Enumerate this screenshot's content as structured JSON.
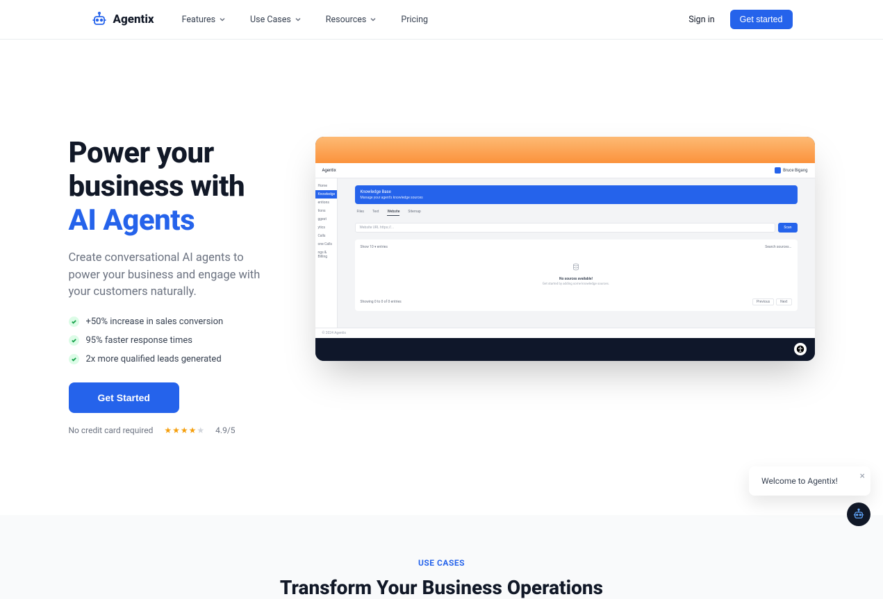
{
  "header": {
    "brand": "Agentix",
    "nav": [
      "Features",
      "Use Cases",
      "Resources",
      "Pricing"
    ],
    "signin": "Sign in",
    "cta": "Get started"
  },
  "hero": {
    "title_a": "Power your business with",
    "title_b": "AI Agents",
    "sub": "Create conversational AI agents to power your business and engage with your customers naturally.",
    "bullets": [
      "+50% increase in sales conversion",
      "95% faster response times",
      "2x more qualified leads generated"
    ],
    "cta": "Get Started",
    "nocc": "No credit card required",
    "rating": "4.9/5"
  },
  "preview": {
    "brand": "Agentix",
    "user": "Bruce Bigang",
    "sidebar": [
      "Home",
      "Knowledge",
      "entions",
      "tions",
      "ggest",
      "ytics",
      "Calls",
      "one Calls",
      "ngs & Billing"
    ],
    "banner_title": "Knowledge Base",
    "banner_sub": "Manage your agent's knowledge sources",
    "tabs": [
      "Files",
      "Text",
      "Website",
      "Sitemap"
    ],
    "url_placeholder": "Website URL https://...",
    "scan": "Scan",
    "show": "Show",
    "entries": "entries",
    "search": "Search sources...",
    "empty_title": "No sources available!",
    "empty_sub": "Get started by adding some knowledge sources.",
    "showing": "Showing 0 to 0 of 0 entries",
    "prev": "Previous",
    "next": "Next",
    "footer": "© 2024 Agentix"
  },
  "section2": {
    "eyebrow": "USE CASES",
    "title": "Transform Your Business Operations"
  },
  "chat": {
    "toast": "Welcome to Agentix!"
  }
}
